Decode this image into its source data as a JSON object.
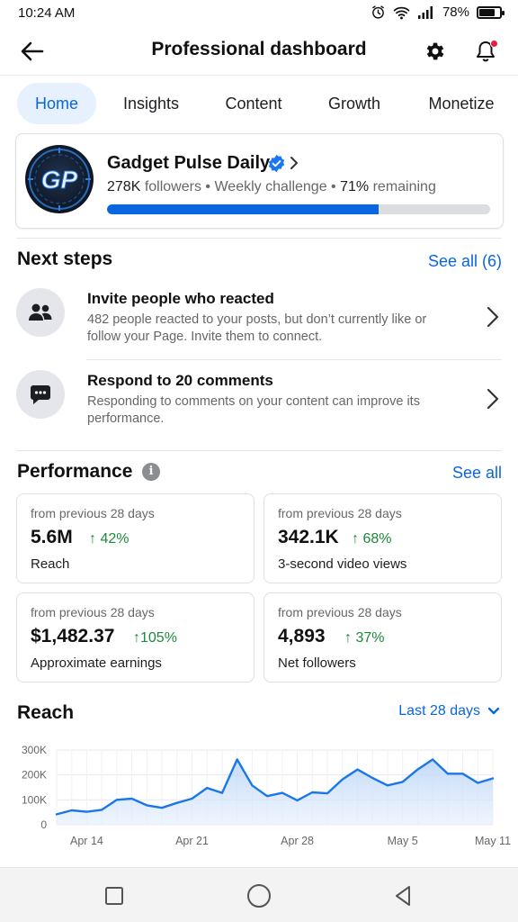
{
  "status_bar": {
    "time": "10:24 AM",
    "battery": "78%",
    "battery_level": 0.78
  },
  "header": {
    "title": "Professional dashboard"
  },
  "tabs": [
    {
      "label": "Home",
      "active": true
    },
    {
      "label": "Insights",
      "active": false
    },
    {
      "label": "Content",
      "active": false
    },
    {
      "label": "Growth",
      "active": false
    },
    {
      "label": "Monetize",
      "active": false
    }
  ],
  "profile": {
    "name": "Gadget Pulse Daily",
    "followers_count": "278K",
    "followers_label": "followers",
    "separator": "•",
    "challenge": "Weekly challenge",
    "remaining_pct": "71%",
    "remaining_label": "remaining",
    "progress_fraction": 0.71,
    "avatar_initials": "GP"
  },
  "next_steps": {
    "title": "Next steps",
    "see_all": "See all (6)",
    "items": [
      {
        "icon": "people-icon",
        "title": "Invite people who reacted",
        "desc": "482 people reacted to your posts, but don’t currently like or follow your Page. Invite them to connect."
      },
      {
        "icon": "comment-icon",
        "title": "Respond to 20 comments",
        "desc": "Responding to comments on your content can improve its performance."
      }
    ]
  },
  "performance": {
    "title": "Performance",
    "info": "i",
    "see_all": "See all",
    "cards": [
      {
        "sub": "from previous 28 days",
        "value": "5.6M",
        "delta": "42%",
        "label": "Reach"
      },
      {
        "sub": "from previous 28 days",
        "value": "342.1K",
        "delta": "68%",
        "label": "3-second video views"
      },
      {
        "sub": "from previous 28 days",
        "value": "$1,482.37",
        "delta": "105%",
        "label": "Approximate earnings"
      },
      {
        "sub": "from previous 28 days",
        "value": "4,893",
        "delta": "37%",
        "label": "Net followers"
      }
    ]
  },
  "reach_chart": {
    "title": "Reach",
    "range": "Last 28 days"
  },
  "chart_data": {
    "type": "area",
    "title": "Reach",
    "ylim": [
      0,
      300000
    ],
    "yticks": [
      0,
      100000,
      200000,
      300000
    ],
    "ytick_labels": [
      "0",
      "100K",
      "200K",
      "300K"
    ],
    "xtick_labels": [
      "Apr 14",
      "Apr 21",
      "Apr 28",
      "May 5",
      "May 11"
    ],
    "xtick_index": [
      2,
      9,
      16,
      23,
      29
    ],
    "grid": true,
    "series": [
      {
        "values": [
          42000,
          58000,
          52000,
          60000,
          100000,
          105000,
          78000,
          68000,
          88000,
          105000,
          148000,
          128000,
          262000,
          158000,
          115000,
          128000,
          98000,
          130000,
          126000,
          182000,
          222000,
          188000,
          158000,
          172000,
          222000,
          262000,
          205000,
          205000,
          168000,
          186000
        ],
        "color": "#1a77e8"
      }
    ]
  },
  "navbar": {
    "buttons": [
      "recent-apps-icon",
      "home-icon",
      "back-icon"
    ]
  }
}
